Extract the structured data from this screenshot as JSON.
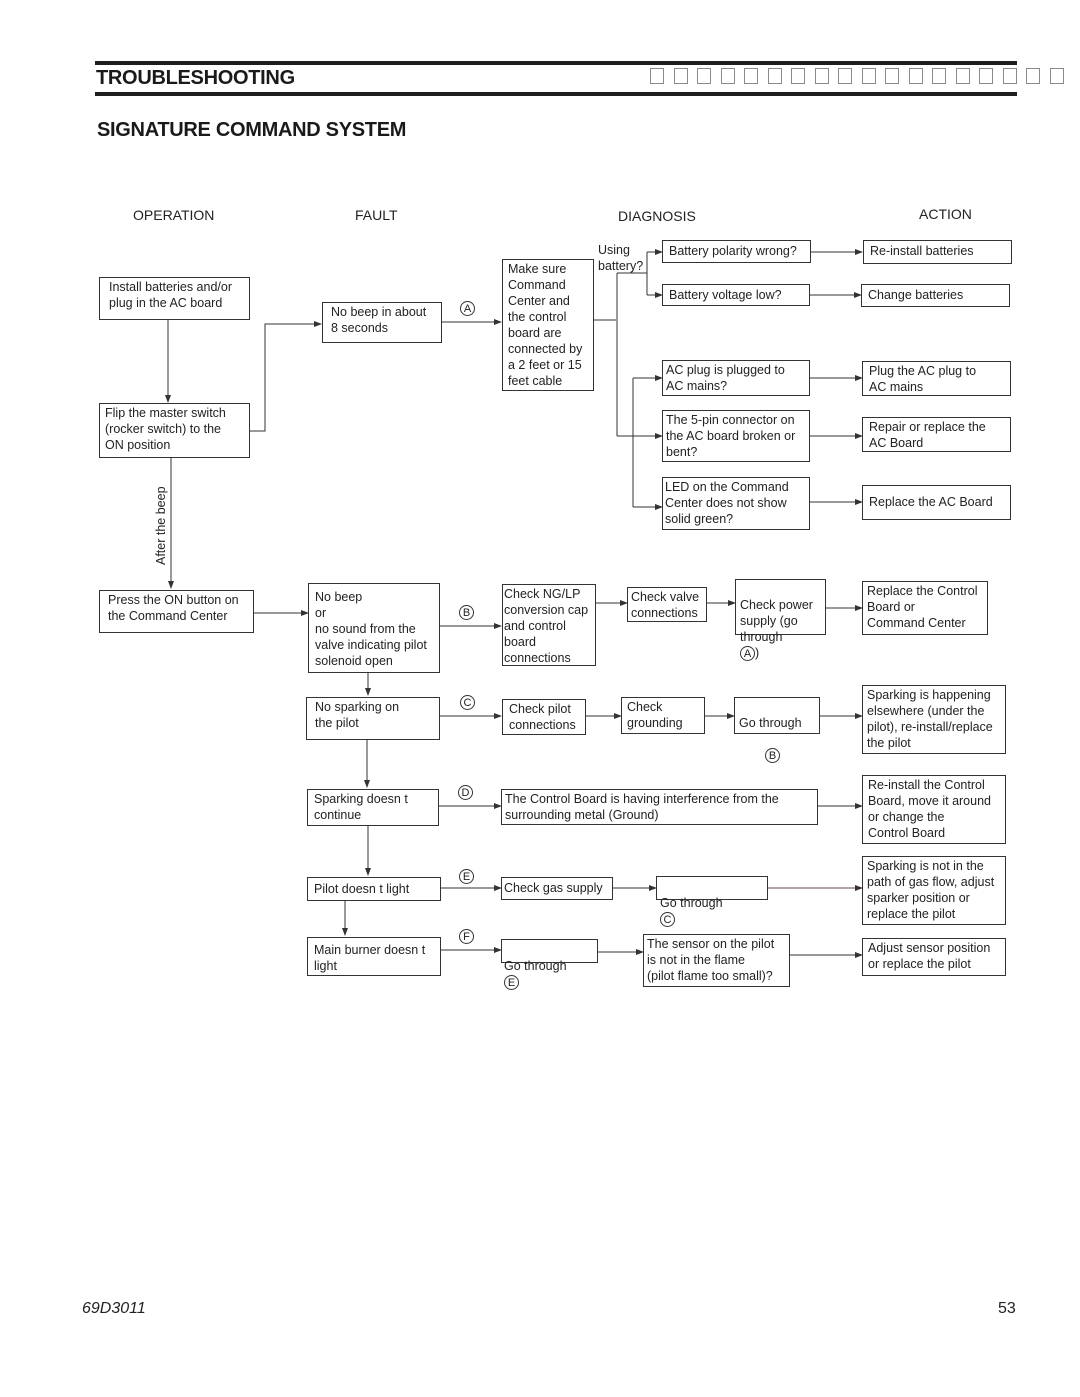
{
  "header": {
    "section": "TROUBLESHOOTING",
    "placeholder_glyph_count": 18,
    "title": "SIGNATURE COMMAND SYSTEM"
  },
  "columns": {
    "operation": "OPERATION",
    "fault": "FAULT",
    "diagnosis": "DIAGNOSIS",
    "action": "ACTION"
  },
  "operation": {
    "install": "Install batteries and/or\nplug in the AC board",
    "flip": "Flip the master switch\n(rocker switch) to the\nON position",
    "after_beep": "After the beep",
    "press_on": "Press the ON button on\nthe Command Center"
  },
  "faults": {
    "no_beep_8s": "No beep in about\n8 seconds",
    "no_beep_or": "No beep\nor\nno sound from the\nvalve indicating pilot\nsolenoid open",
    "no_sparking": "No sparking on\nthe pilot",
    "sparking_doesnt_continue": "Sparking doesn t\ncontinue",
    "pilot_doesnt_light": "Pilot doesn t light",
    "main_burner": "Main burner doesn t\nlight"
  },
  "markers": {
    "a": "A",
    "b": "B",
    "c": "C",
    "d": "D",
    "e": "E",
    "f": "F"
  },
  "diagnosis": {
    "make_sure": "Make sure\nCommand\nCenter and\nthe control\nboard are\nconnected by\na 2 feet or 15\nfeet cable",
    "using_battery": "Using\nbattery?",
    "polarity": "Battery polarity wrong?",
    "voltage": "Battery voltage low?",
    "ac_plug": "AC plug is plugged to\nAC mains?",
    "pin_connector": "The 5-pin connector on\nthe AC board broken or\nbent?",
    "led": "LED on the Command\nCenter does not show\nsolid green?",
    "check_ng_lp": "Check NG/LP\nconversion cap\nand control\nboard\nconnections",
    "check_valve": "Check valve\nconnections",
    "check_power_prefix": "Check power\nsupply (go\nthrough",
    "check_power_suffix": ")",
    "check_pilot_conn": "Check pilot\nconnections",
    "check_grounding": "Check\ngrounding",
    "go_through": "Go through",
    "interference": "The Control Board is having interference from the\nsurrounding metal (Ground)",
    "check_gas": "Check gas supply",
    "sensor": "The sensor on the pilot\nis not in the flame\n(pilot flame too small)?"
  },
  "actions": {
    "reinstall_batteries": "Re-install batteries",
    "change_batteries": "Change batteries",
    "plug_ac": "Plug the AC plug to\nAC mains",
    "repair_ac": "Repair or replace the\nAC Board",
    "replace_ac": "Replace the AC Board",
    "replace_control": "Replace the Control\nBoard or\nCommand Center",
    "sparking_elsewhere": "Sparking is happening\nelsewhere (under the\npilot), re-install/replace\nthe pilot",
    "reinstall_control": "Re-install the Control\nBoard, move it around\nor change the\nControl Board",
    "sparking_not_in_path": "Sparking is not in the\npath of gas flow, adjust\nsparker position or\nreplace the pilot",
    "adjust_sensor": "Adjust sensor position\nor replace the pilot"
  },
  "footer": {
    "doc_number": "69D3011",
    "page_number": "53"
  }
}
